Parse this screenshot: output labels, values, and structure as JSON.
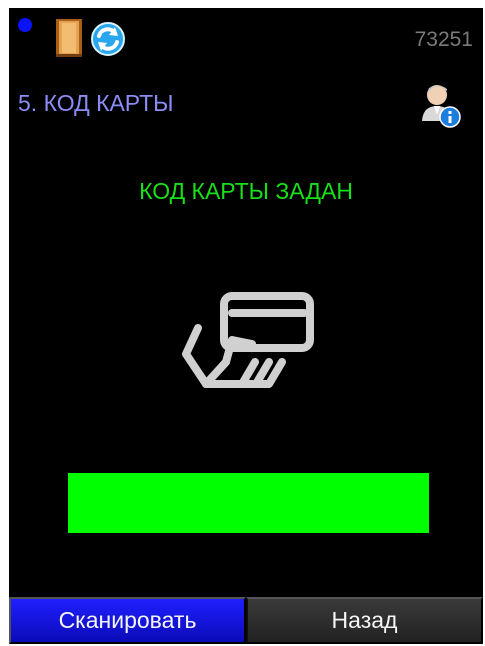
{
  "header": {
    "status_color": "#0a12ff",
    "door_icon": "door-icon",
    "sync_icon": "sync-icon",
    "device_id": "73251"
  },
  "title": {
    "label": "5. КОД КАРТЫ",
    "user_icon": "user-info-icon"
  },
  "status": {
    "message": "КОД КАРТЫ ЗАДАН",
    "color": "#18e018"
  },
  "card_prompt": {
    "icon": "hand-card-icon"
  },
  "progress": {
    "value_percent": 100,
    "color": "#00ff00"
  },
  "buttons": {
    "scan_label": "Сканировать",
    "back_label": "Назад"
  }
}
